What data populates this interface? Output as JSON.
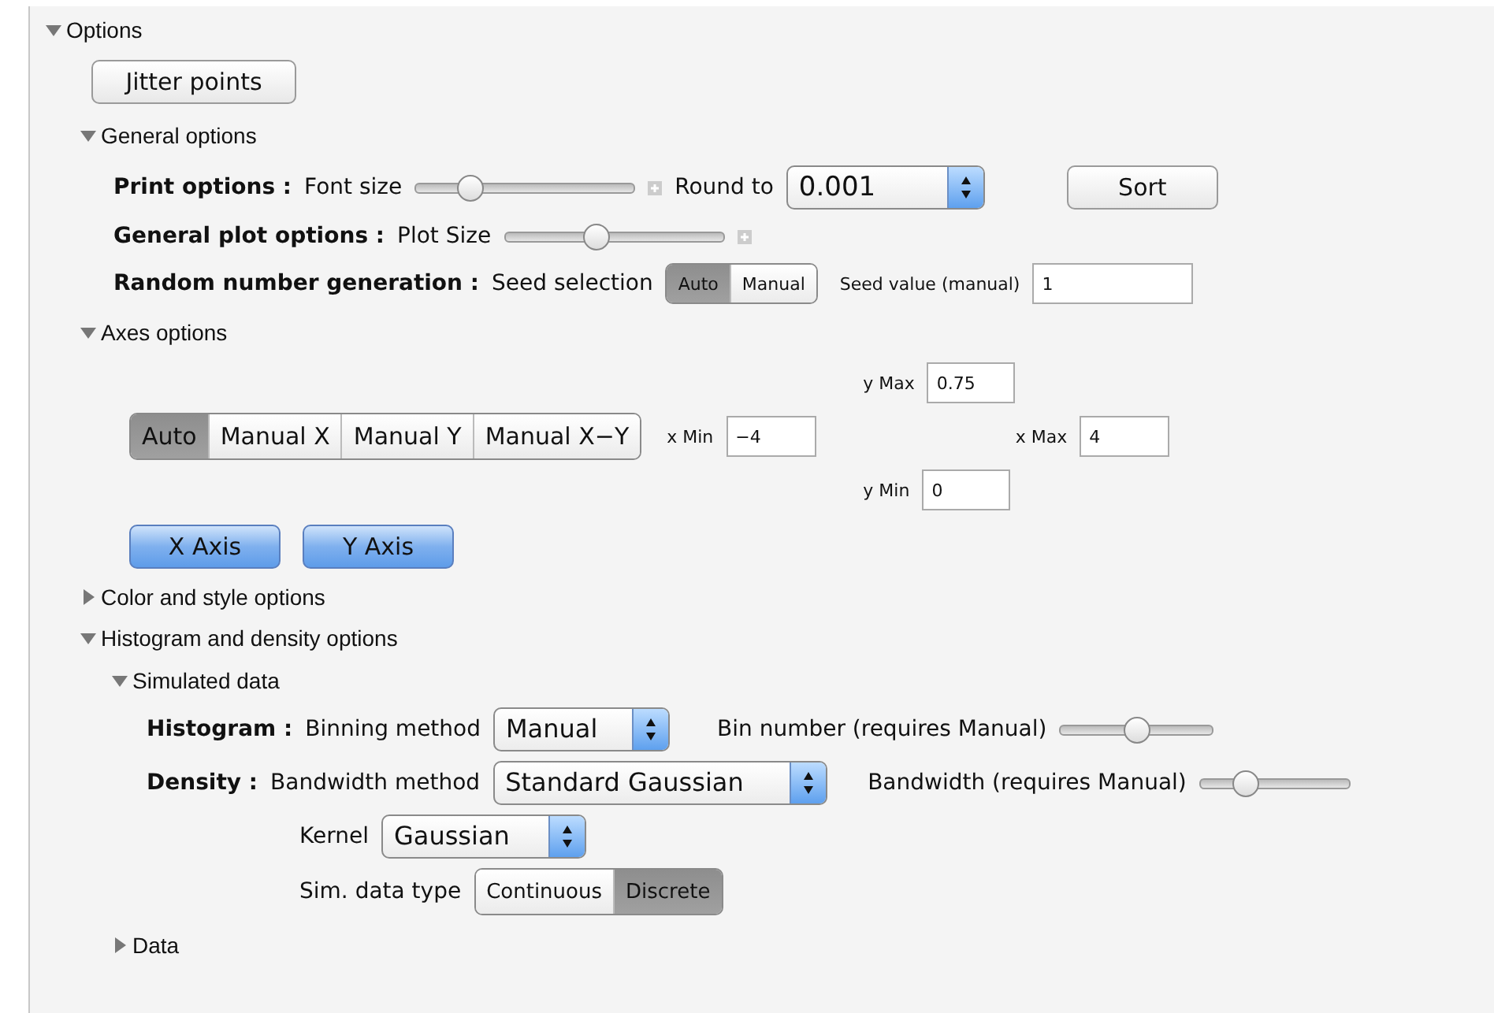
{
  "options": {
    "label": "Options",
    "expanded": true
  },
  "jitter_button": "Jitter points",
  "general": {
    "label": "General options",
    "expanded": true,
    "print": {
      "label": "Print options :",
      "font_size_label": "Font size",
      "font_slider": {
        "level": 0.25
      },
      "round_label": "Round to",
      "round_value": "0.001"
    },
    "sort_button": "Sort",
    "plot": {
      "label": "General plot options :",
      "size_label": "Plot Size",
      "level": 0.42
    },
    "random": {
      "label": "Random number generation :",
      "seed_label": "Seed selection",
      "seed_modes": [
        {
          "label": "Auto",
          "selected": true
        },
        {
          "label": "Manual",
          "selected": false
        }
      ],
      "seed_value_label": "Seed value (manual)",
      "seed_value": "1"
    }
  },
  "axes": {
    "label": "Axes options",
    "expanded": true,
    "modes": [
      {
        "label": "Auto",
        "selected": true
      },
      {
        "label": "Manual X",
        "selected": false
      },
      {
        "label": "Manual Y",
        "selected": false
      },
      {
        "label": "Manual X−Y",
        "selected": false
      }
    ],
    "ymax_label": "y Max",
    "ymax": "0.75",
    "xmin_label": "x Min",
    "xmin": "−4",
    "xmax_label": "x Max",
    "xmax": "4",
    "ymin_label": "y Min",
    "ymin": "0",
    "buttons": [
      "X Axis",
      "Y Axis"
    ]
  },
  "color_style": {
    "label": "Color and style options",
    "expanded": false
  },
  "histogram": {
    "label": "Histogram and density options",
    "expanded": true,
    "simulated": {
      "label": "Simulated data",
      "expanded": true,
      "hist_label": "Histogram :",
      "binning_label": "Binning method",
      "binning_value": "Manual",
      "bin_number_label": "Bin number (requires Manual)",
      "bin_slider": {
        "level": 0.5
      },
      "density_label": "Density :",
      "bw_method_label": "Bandwidth method",
      "bw_method_value": "Standard Gaussian",
      "bw_label": "Bandwidth (requires Manual)",
      "bw_slider": {
        "level": 0.3
      },
      "kernel_label": "Kernel",
      "kernel_value": "Gaussian",
      "sim_type_label": "Sim. data type",
      "sim_types": [
        {
          "label": "Continuous",
          "selected": false
        },
        {
          "label": "Discrete",
          "selected": true
        }
      ]
    },
    "data": {
      "label": "Data",
      "expanded": false
    }
  }
}
